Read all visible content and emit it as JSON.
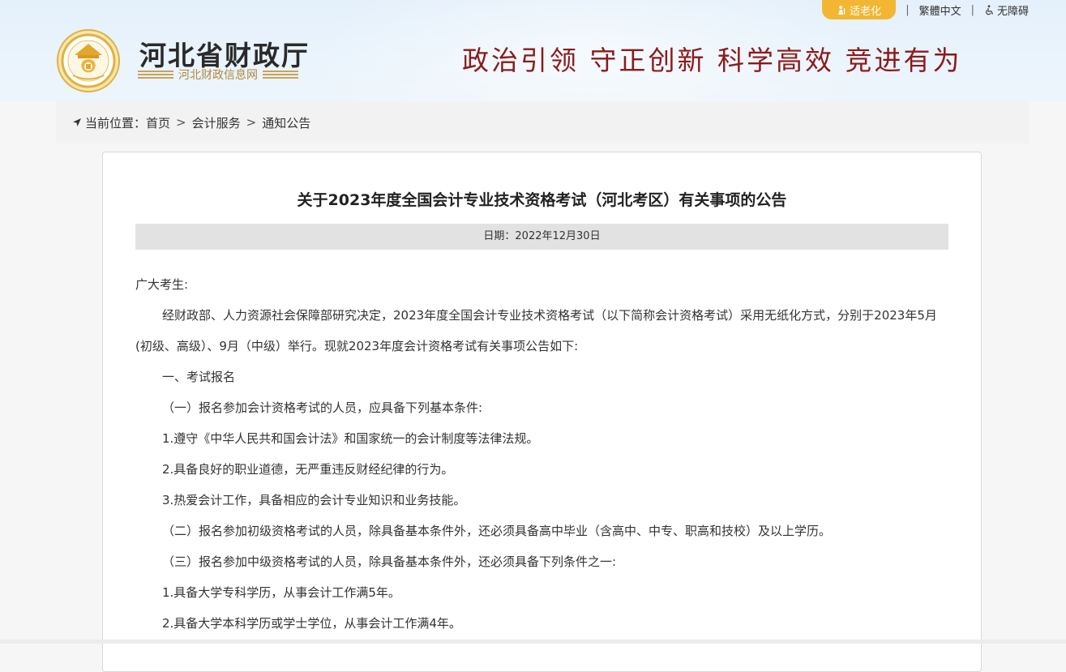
{
  "header": {
    "site_name": "河北省财政厅",
    "site_sub": "河北财政信息网",
    "slogan": "政治引领  守正创新  科学高效  竞进有为",
    "elder_label": "适老化",
    "traditional_label": "繁體中文",
    "accessibility_label": "无障碍",
    "emblem_text": "河北省财政厅"
  },
  "breadcrumb": {
    "prefix": "当前位置：",
    "items": [
      "首页",
      "会计服务",
      "通知公告"
    ],
    "sep": ">"
  },
  "article": {
    "title": "关于2023年度全国会计专业技术资格考试（河北考区）有关事项的公告",
    "date": "日期：2022年12月30日",
    "paragraphs": [
      "广大考生:",
      "经财政部、人力资源社会保障部研究决定，2023年度全国会计专业技术资格考试（以下简称会计资格考试）采用无纸化方式，分别于2023年5月(初级、高级）、9月（中级）举行。现就2023年度会计资格考试有关事项公告如下:",
      "一、考试报名",
      "（一）报名参加会计资格考试的人员，应具备下列基本条件:",
      "1.遵守《中华人民共和国会计法》和国家统一的会计制度等法律法规。",
      "2.具备良好的职业道德，无严重违反财经纪律的行为。",
      "3.热爱会计工作，具备相应的会计专业知识和业务技能。",
      "（二）报名参加初级资格考试的人员，除具备基本条件外，还必须具备高中毕业（含高中、中专、职高和技校）及以上学历。",
      "（三）报名参加中级资格考试的人员，除具备基本条件外，还必须具备下列条件之一:",
      "1.具备大学专科学历，从事会计工作满5年。",
      "2.具备大学本科学历或学士学位，从事会计工作满4年。"
    ]
  },
  "colors": {
    "slogan": "#8b1a1a",
    "elder_button": "#f2b632",
    "emblem_gold": "#e0b23c"
  }
}
